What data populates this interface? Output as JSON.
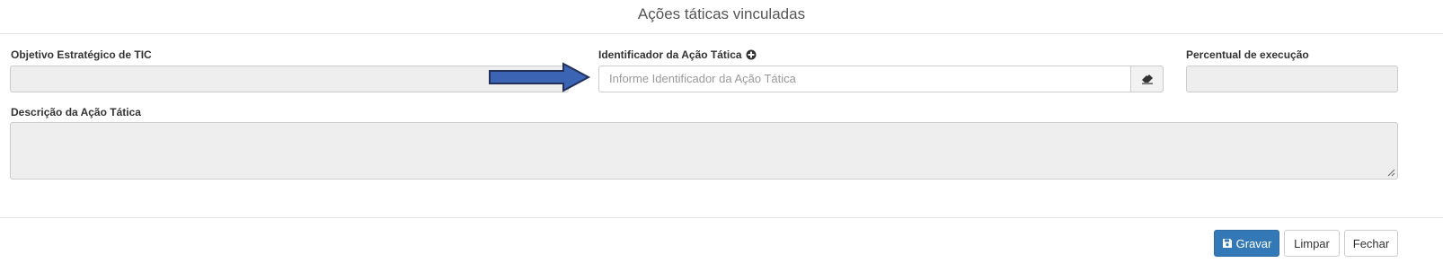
{
  "modal": {
    "title": "Ações táticas vinculadas"
  },
  "form": {
    "objetivo": {
      "label": "Objetivo Estratégico de TIC",
      "value": ""
    },
    "identificador": {
      "label": "Identificador da Ação Tática",
      "placeholder": "Informe Identificador da Ação Tática",
      "add_icon": "plus-circle-icon",
      "clear_icon": "eraser-icon"
    },
    "percentual": {
      "label": "Percentual de execução",
      "value": ""
    },
    "descricao": {
      "label": "Descrição da Ação Tática",
      "value": ""
    }
  },
  "annotation": {
    "icon": "arrow-right-icon",
    "color": "#3c64b4"
  },
  "footer": {
    "save_label": "Gravar",
    "save_icon": "floppy-disk-icon",
    "clear_label": "Limpar",
    "close_label": "Fechar"
  },
  "colors": {
    "primary": "#3479b7",
    "disabled_input": "#eeeeee",
    "border": "#cccccc"
  }
}
